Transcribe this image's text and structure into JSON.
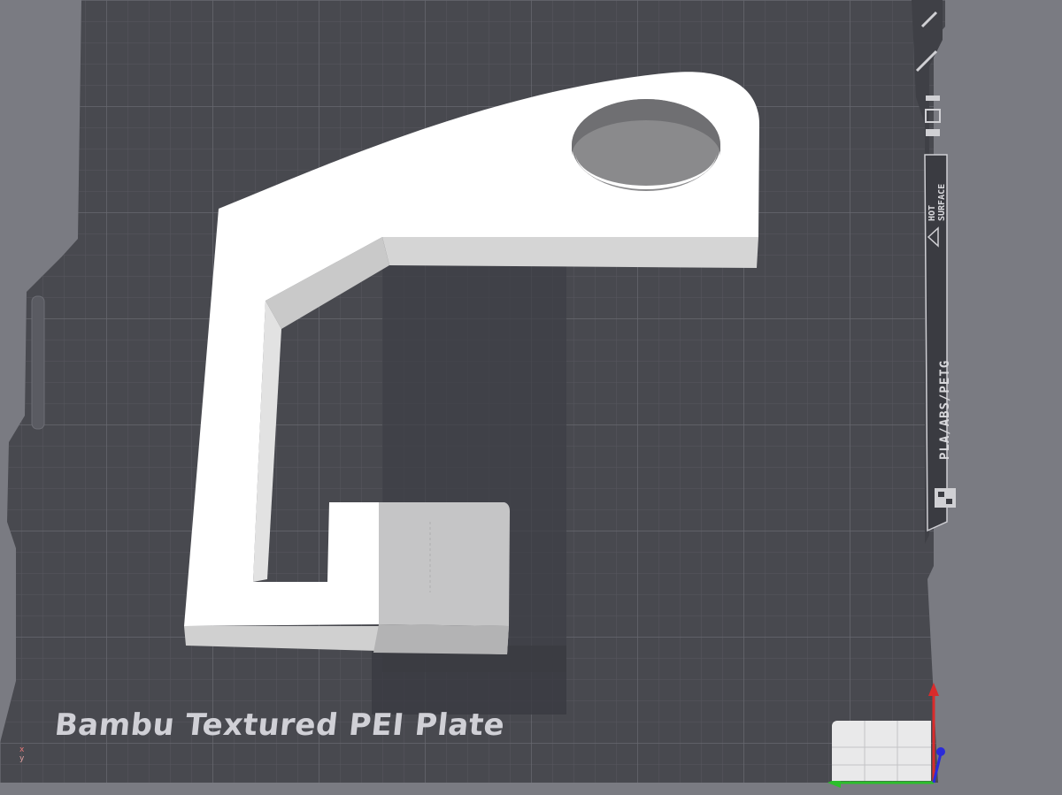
{
  "plate": {
    "name": "Bambu Textured PEI Plate",
    "materials": "PLA/ABS/PETG",
    "hot_surface_line1": "HOT",
    "hot_surface_line2": "SURFACE",
    "colors": {
      "background": "#7a7b82",
      "plate": "#494a50",
      "grid": "#5d5e65",
      "model": "#ffffff",
      "model_side": "#d8d8d8",
      "selected": "#c4c4c4"
    }
  },
  "axes": {
    "mini_label_x": "x",
    "mini_label_y": "y",
    "x_color": "#2bbf2b",
    "y_color": "#d92b2b",
    "z_color": "#2b2bd9"
  },
  "icons": [
    "warning-icon",
    "bambu-logo-icon",
    "orientation-cube-icon"
  ]
}
